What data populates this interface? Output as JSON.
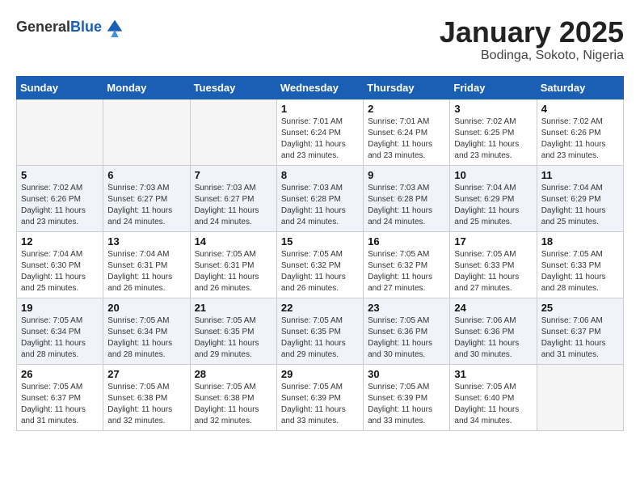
{
  "header": {
    "logo": {
      "general": "General",
      "blue": "Blue"
    },
    "title": "January 2025",
    "location": "Bodinga, Sokoto, Nigeria"
  },
  "weekdays": [
    "Sunday",
    "Monday",
    "Tuesday",
    "Wednesday",
    "Thursday",
    "Friday",
    "Saturday"
  ],
  "weeks": [
    [
      {
        "day": "",
        "info": ""
      },
      {
        "day": "",
        "info": ""
      },
      {
        "day": "",
        "info": ""
      },
      {
        "day": "1",
        "info": "Sunrise: 7:01 AM\nSunset: 6:24 PM\nDaylight: 11 hours\nand 23 minutes."
      },
      {
        "day": "2",
        "info": "Sunrise: 7:01 AM\nSunset: 6:24 PM\nDaylight: 11 hours\nand 23 minutes."
      },
      {
        "day": "3",
        "info": "Sunrise: 7:02 AM\nSunset: 6:25 PM\nDaylight: 11 hours\nand 23 minutes."
      },
      {
        "day": "4",
        "info": "Sunrise: 7:02 AM\nSunset: 6:26 PM\nDaylight: 11 hours\nand 23 minutes."
      }
    ],
    [
      {
        "day": "5",
        "info": "Sunrise: 7:02 AM\nSunset: 6:26 PM\nDaylight: 11 hours\nand 23 minutes."
      },
      {
        "day": "6",
        "info": "Sunrise: 7:03 AM\nSunset: 6:27 PM\nDaylight: 11 hours\nand 24 minutes."
      },
      {
        "day": "7",
        "info": "Sunrise: 7:03 AM\nSunset: 6:27 PM\nDaylight: 11 hours\nand 24 minutes."
      },
      {
        "day": "8",
        "info": "Sunrise: 7:03 AM\nSunset: 6:28 PM\nDaylight: 11 hours\nand 24 minutes."
      },
      {
        "day": "9",
        "info": "Sunrise: 7:03 AM\nSunset: 6:28 PM\nDaylight: 11 hours\nand 24 minutes."
      },
      {
        "day": "10",
        "info": "Sunrise: 7:04 AM\nSunset: 6:29 PM\nDaylight: 11 hours\nand 25 minutes."
      },
      {
        "day": "11",
        "info": "Sunrise: 7:04 AM\nSunset: 6:29 PM\nDaylight: 11 hours\nand 25 minutes."
      }
    ],
    [
      {
        "day": "12",
        "info": "Sunrise: 7:04 AM\nSunset: 6:30 PM\nDaylight: 11 hours\nand 25 minutes."
      },
      {
        "day": "13",
        "info": "Sunrise: 7:04 AM\nSunset: 6:31 PM\nDaylight: 11 hours\nand 26 minutes."
      },
      {
        "day": "14",
        "info": "Sunrise: 7:05 AM\nSunset: 6:31 PM\nDaylight: 11 hours\nand 26 minutes."
      },
      {
        "day": "15",
        "info": "Sunrise: 7:05 AM\nSunset: 6:32 PM\nDaylight: 11 hours\nand 26 minutes."
      },
      {
        "day": "16",
        "info": "Sunrise: 7:05 AM\nSunset: 6:32 PM\nDaylight: 11 hours\nand 27 minutes."
      },
      {
        "day": "17",
        "info": "Sunrise: 7:05 AM\nSunset: 6:33 PM\nDaylight: 11 hours\nand 27 minutes."
      },
      {
        "day": "18",
        "info": "Sunrise: 7:05 AM\nSunset: 6:33 PM\nDaylight: 11 hours\nand 28 minutes."
      }
    ],
    [
      {
        "day": "19",
        "info": "Sunrise: 7:05 AM\nSunset: 6:34 PM\nDaylight: 11 hours\nand 28 minutes."
      },
      {
        "day": "20",
        "info": "Sunrise: 7:05 AM\nSunset: 6:34 PM\nDaylight: 11 hours\nand 28 minutes."
      },
      {
        "day": "21",
        "info": "Sunrise: 7:05 AM\nSunset: 6:35 PM\nDaylight: 11 hours\nand 29 minutes."
      },
      {
        "day": "22",
        "info": "Sunrise: 7:05 AM\nSunset: 6:35 PM\nDaylight: 11 hours\nand 29 minutes."
      },
      {
        "day": "23",
        "info": "Sunrise: 7:05 AM\nSunset: 6:36 PM\nDaylight: 11 hours\nand 30 minutes."
      },
      {
        "day": "24",
        "info": "Sunrise: 7:06 AM\nSunset: 6:36 PM\nDaylight: 11 hours\nand 30 minutes."
      },
      {
        "day": "25",
        "info": "Sunrise: 7:06 AM\nSunset: 6:37 PM\nDaylight: 11 hours\nand 31 minutes."
      }
    ],
    [
      {
        "day": "26",
        "info": "Sunrise: 7:05 AM\nSunset: 6:37 PM\nDaylight: 11 hours\nand 31 minutes."
      },
      {
        "day": "27",
        "info": "Sunrise: 7:05 AM\nSunset: 6:38 PM\nDaylight: 11 hours\nand 32 minutes."
      },
      {
        "day": "28",
        "info": "Sunrise: 7:05 AM\nSunset: 6:38 PM\nDaylight: 11 hours\nand 32 minutes."
      },
      {
        "day": "29",
        "info": "Sunrise: 7:05 AM\nSunset: 6:39 PM\nDaylight: 11 hours\nand 33 minutes."
      },
      {
        "day": "30",
        "info": "Sunrise: 7:05 AM\nSunset: 6:39 PM\nDaylight: 11 hours\nand 33 minutes."
      },
      {
        "day": "31",
        "info": "Sunrise: 7:05 AM\nSunset: 6:40 PM\nDaylight: 11 hours\nand 34 minutes."
      },
      {
        "day": "",
        "info": ""
      }
    ]
  ]
}
